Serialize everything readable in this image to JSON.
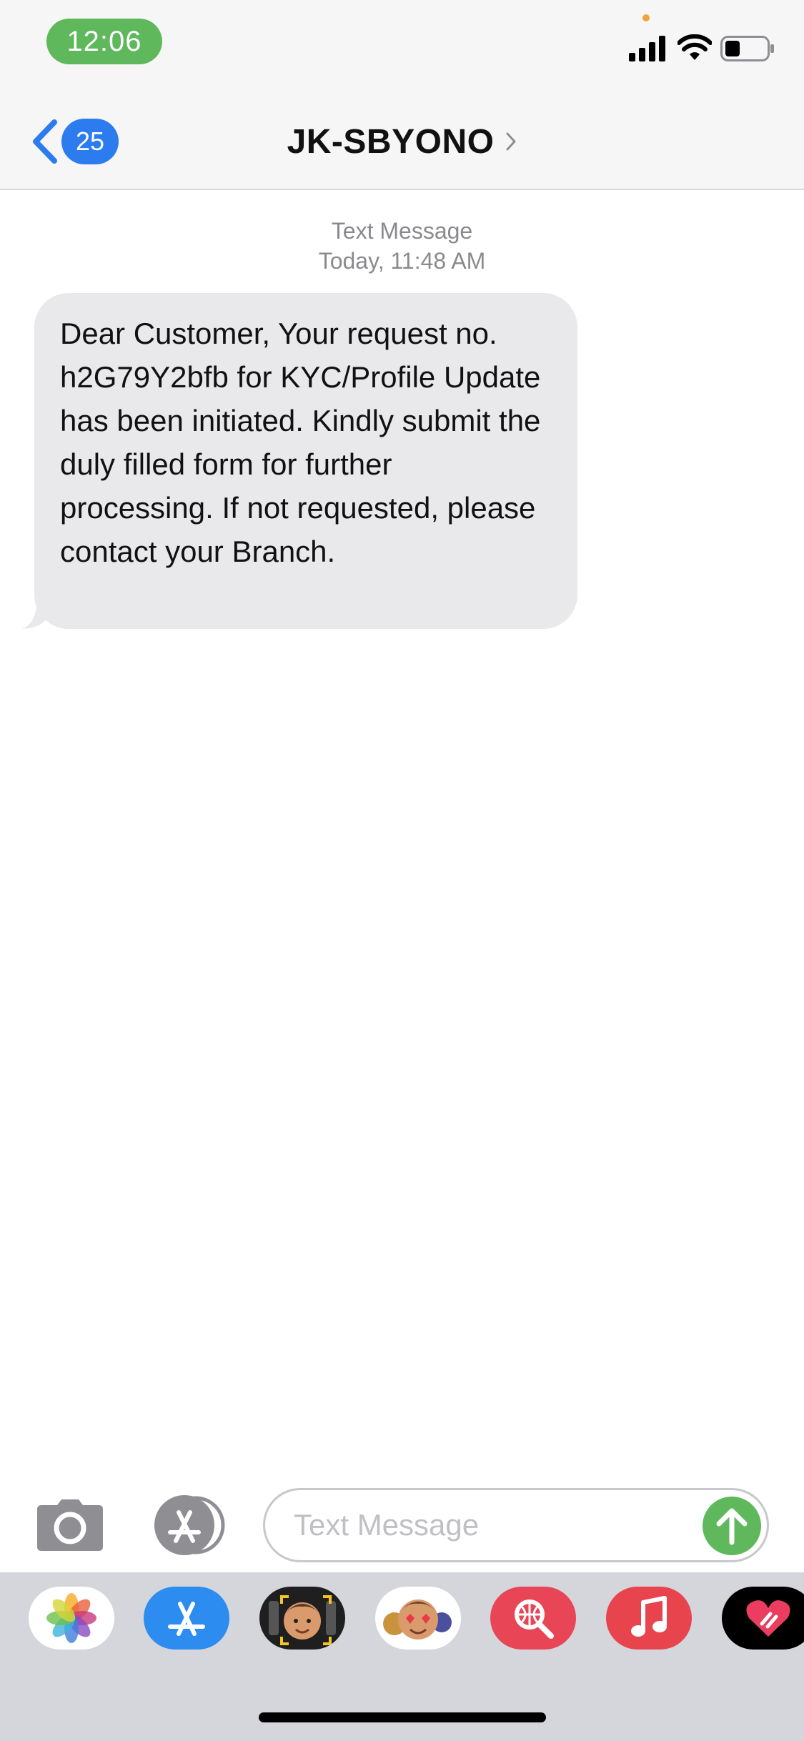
{
  "status_bar": {
    "time": "12:06"
  },
  "nav": {
    "back_count": "25",
    "contact_name": "JK-SBYONO"
  },
  "conversation": {
    "message_type": "Text Message",
    "timestamp": "Today, 11:48 AM",
    "messages": [
      {
        "direction": "incoming",
        "text": "Dear Customer, Your request no. h2G79Y2bfb for KYC/Profile Update has been initiated. Kindly submit the duly filled form for further processing. If not requested, please contact your Branch."
      }
    ]
  },
  "composer": {
    "placeholder": "Text Message"
  },
  "app_drawer": {
    "apps": [
      "photos-icon",
      "app-store-icon",
      "memoji-icon",
      "animoji-stickers-icon",
      "web-images-icon",
      "music-icon",
      "digital-touch-icon"
    ]
  },
  "colors": {
    "accent": "#2c7cf0",
    "send": "#5fb85c",
    "bubble": "#e9e9eb"
  }
}
